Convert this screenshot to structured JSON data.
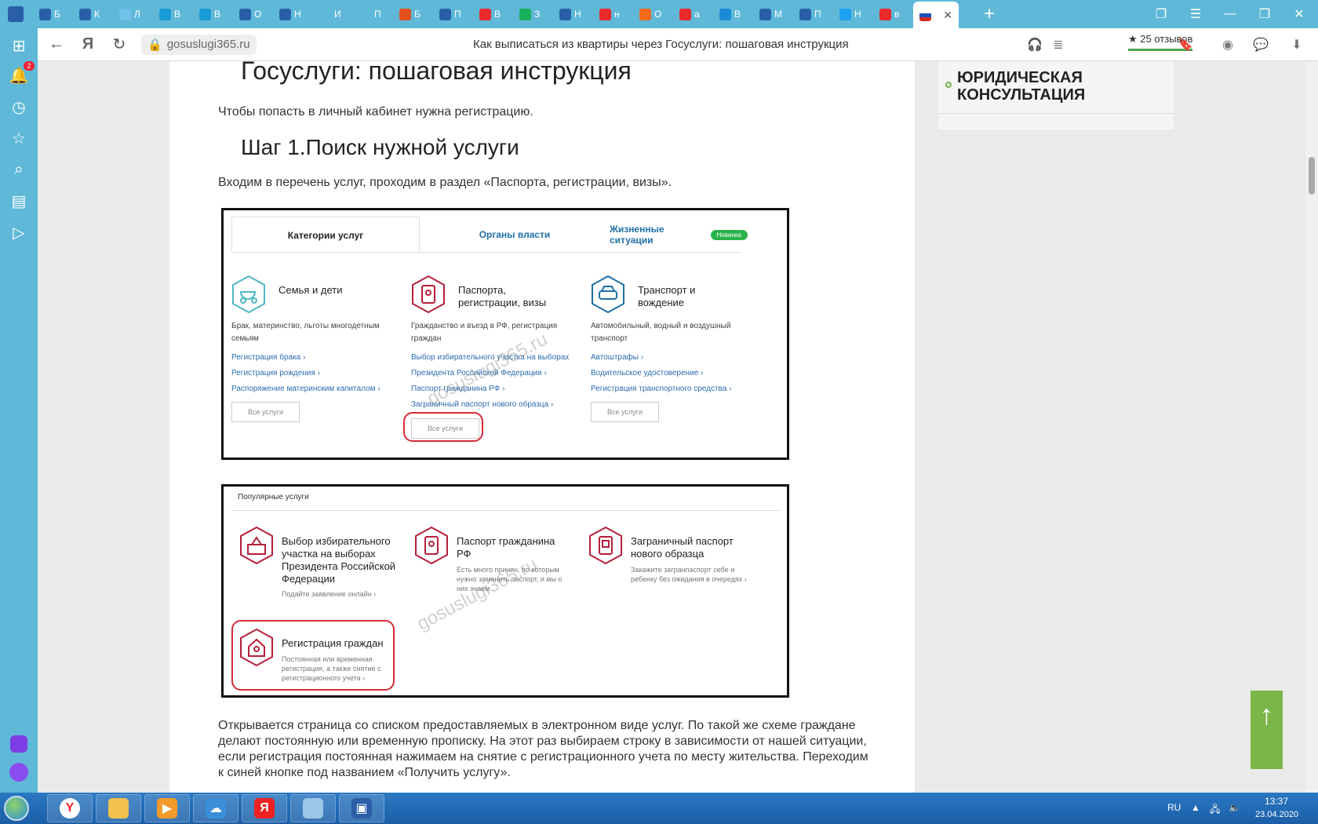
{
  "browser": {
    "tabs": [
      {
        "label": "Б",
        "color": "#2a5fa8"
      },
      {
        "label": "К",
        "color": "#2a5fa8"
      },
      {
        "label": "Л",
        "color": "#6ec2e8"
      },
      {
        "label": "В",
        "color": "#1a9bd6"
      },
      {
        "label": "В",
        "color": "#1a9bd6"
      },
      {
        "label": "О",
        "color": "#2a5fa8"
      },
      {
        "label": "Н",
        "color": "#2a5fa8"
      },
      {
        "label": "И",
        "color": "#5fb8d8"
      },
      {
        "label": "П",
        "color": "#5fb8d8"
      },
      {
        "label": "Б",
        "color": "#e2511b"
      },
      {
        "label": "П",
        "color": "#2a5fa8"
      },
      {
        "label": "В",
        "color": "#e82a2a"
      },
      {
        "label": "З",
        "color": "#18b05a"
      },
      {
        "label": "Н",
        "color": "#2a5fa8"
      },
      {
        "label": "н",
        "color": "#e82a2a"
      },
      {
        "label": "О",
        "color": "#f26a1b"
      },
      {
        "label": "а",
        "color": "#e82a2a"
      },
      {
        "label": "В",
        "color": "#1a8ad6"
      },
      {
        "label": "М",
        "color": "#2a5fa8"
      },
      {
        "label": "П",
        "color": "#2a5fa8"
      },
      {
        "label": "Н",
        "color": "#1da1f2"
      },
      {
        "label": "в",
        "color": "#e82a2a"
      }
    ],
    "active_tab_flag": "russia-flag-icon",
    "url": "gosuslugi365.ru",
    "page_title": "Как выписаться из квартиры через Госуслуги: пошаговая инструкция",
    "reviews": "★ 25 отзывов",
    "notification_count": "2"
  },
  "article": {
    "heading1": "Госуслуги: пошаговая инструкция",
    "intro": "Чтобы попасть в личный кабинет нужна регистрацию.",
    "heading2": "Шаг 1.Поиск нужной услуги",
    "step1_text": "Входим в перечень услуг, проходим в раздел «Паспорта, регистрации, визы».",
    "closing_text": "Открывается страница со списком предоставляемых в электронном виде услуг. По такой же схеме граждане делают постоянную или временную прописку. На этот раз выбираем строку в зависимости от нашей ситуации, если регистрация постоянная нажимаем на снятие с регистрационного учета по месту жительства. Переходим к синей кнопке под названием «Получить услугу»."
  },
  "screenshot1": {
    "tabs": [
      "Категории услуг",
      "Органы власти",
      "Жизненные ситуации"
    ],
    "new_badge": "Новинка",
    "columns": [
      {
        "title": "Семья и дети",
        "desc": "Брак, материнство, льготы многодетным семьям",
        "links": [
          "Регистрация брака ›",
          "Регистрация рождения ›",
          "Распоряжение материнским капиталом ›"
        ],
        "button": "Все услуги"
      },
      {
        "title": "Паспорта, регистрации, визы",
        "desc": "Гражданство и въезд в РФ, регистрация граждан",
        "links": [
          "Выбор избирательного участка на выборах",
          "Президента Российской Федерации ›",
          "Паспорт гражданина РФ ›",
          "Заграничный паспорт нового образца ›"
        ],
        "button": "Все услуги"
      },
      {
        "title": "Транспорт и вождение",
        "desc": "Автомобильный, водный и воздушный транспорт",
        "links": [
          "Автоштрафы ›",
          "Водительское удостоверение ›",
          "Регистрация транспортного средства ›"
        ],
        "button": "Все услуги"
      }
    ],
    "watermark": "gosuslugi365.ru"
  },
  "screenshot2": {
    "title": "Популярные услуги",
    "items": [
      {
        "title": "Выбор избирательного участка на выборах Президента Российской Федерации",
        "desc": "Подайте заявление онлайн ›"
      },
      {
        "title": "Паспорт гражданина РФ",
        "desc": "Есть много причин, по которым нужно заменить паспорт, и мы о них знаем"
      },
      {
        "title": "Заграничный паспорт нового образца",
        "desc": "Закажите загранпаспорт себе и ребенку без ожидания в очередях ›"
      },
      {
        "title": "Регистрация граждан",
        "desc": "Постоянная или временная регистрация, а также снятие с регистрационного учета ›"
      }
    ],
    "watermark": "gosuslugi365.ru"
  },
  "sidebar_card": {
    "title": "ЮРИДИЧЕСКАЯ КОНСУЛЬТАЦИЯ"
  },
  "taskbar": {
    "lang": "RU",
    "time": "13:37",
    "date": "23.04.2020"
  }
}
